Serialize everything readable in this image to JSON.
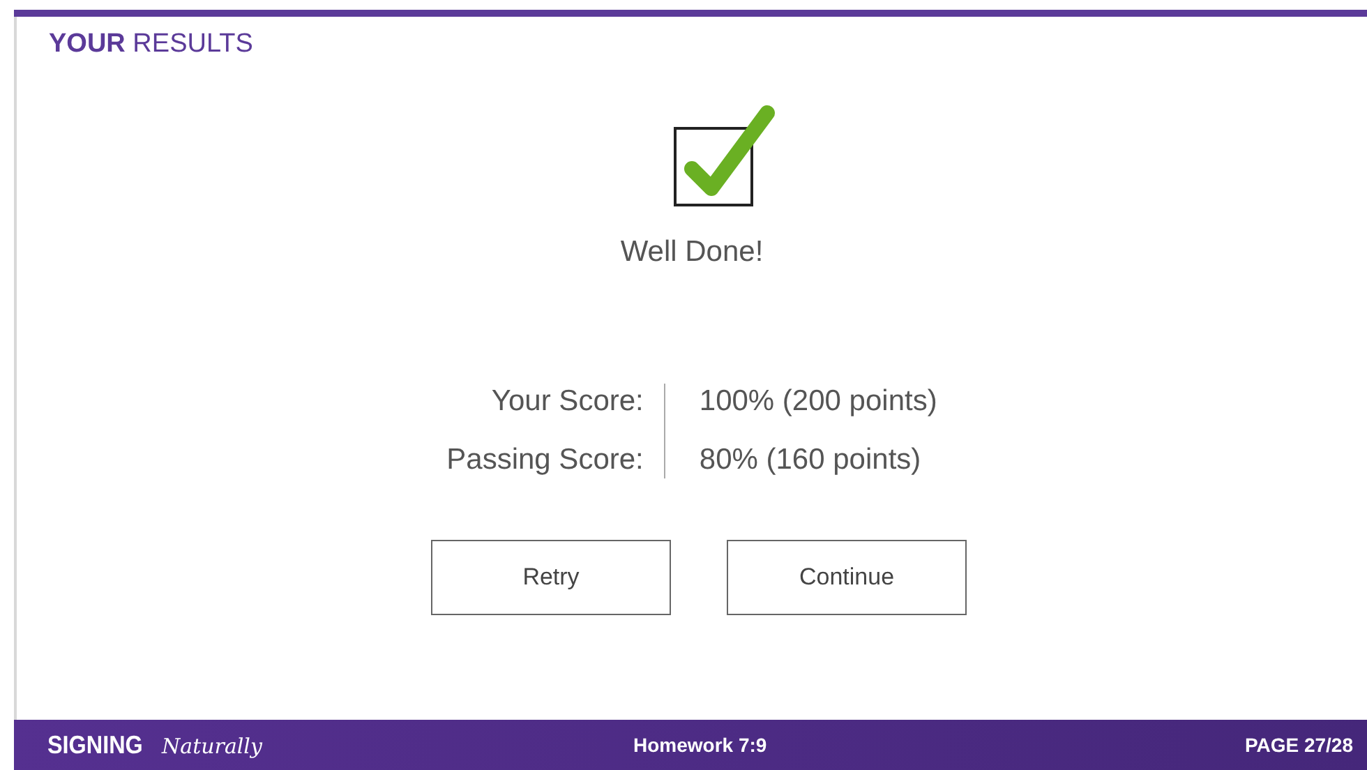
{
  "header": {
    "title": "**YOUR** RESULTS"
  },
  "result": {
    "passed": true,
    "message": "Well Done!"
  },
  "scores": [
    {
      "label": "Your Score:",
      "value": "100% (200 points)"
    },
    {
      "label": "Passing Score:",
      "value": "80% (160 points)"
    }
  ],
  "buttons": [
    "Retry",
    "Continue"
  ],
  "footer": {
    "logo_word": "SIGNING",
    "logo_script": "Naturally",
    "lesson": "Homework 7:9",
    "page": "PAGE 27/28"
  }
}
